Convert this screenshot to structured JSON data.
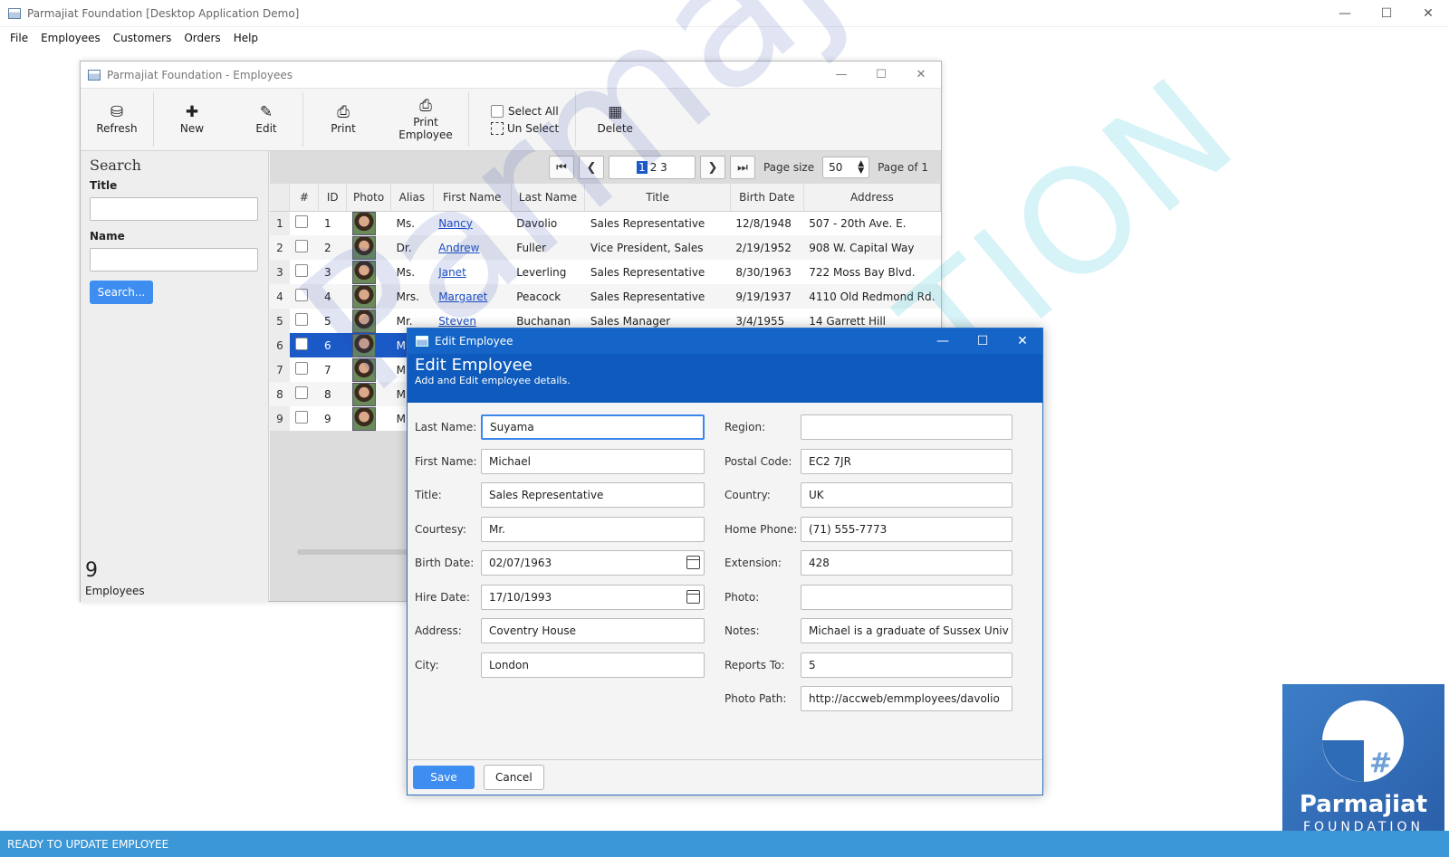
{
  "app": {
    "title": "Parmajiat Foundation [Desktop Application Demo]",
    "menu": [
      "File",
      "Employees",
      "Customers",
      "Orders",
      "Help"
    ],
    "status": "READY TO UPDATE EMPLOYEE"
  },
  "employees_window": {
    "title": "Parmajiat Foundation - Employees",
    "toolbar": {
      "refresh": "Refresh",
      "new": "New",
      "edit": "Edit",
      "print": "Print",
      "print_employee_1": "Print",
      "print_employee_2": "Employee",
      "select_all": "Select All",
      "un_select": "Un Select",
      "delete": "Delete"
    },
    "search": {
      "heading": "Search",
      "title_label": "Title",
      "name_label": "Name",
      "button": "Search..."
    },
    "count": "9",
    "count_label": "Employees",
    "pager": {
      "current_page": "1",
      "other_pages": "2 3",
      "page_size_label": "Page size",
      "page_size": "50",
      "page_of": "Page  of 1"
    },
    "columns": [
      "#",
      "ID",
      "Photo",
      "Alias",
      "First Name",
      "Last Name",
      "Title",
      "Birth Date",
      "Address"
    ],
    "rows": [
      {
        "num": "1",
        "id": "1",
        "alias": "Ms.",
        "first": "Nancy",
        "last": "Davolio",
        "title": "Sales Representative",
        "birth": "12/8/1948",
        "address": "507 - 20th Ave. E."
      },
      {
        "num": "2",
        "id": "2",
        "alias": "Dr.",
        "first": "Andrew",
        "last": "Fuller",
        "title": "Vice President, Sales",
        "birth": "2/19/1952",
        "address": "908 W. Capital Way"
      },
      {
        "num": "3",
        "id": "3",
        "alias": "Ms.",
        "first": "Janet",
        "last": "Leverling",
        "title": "Sales Representative",
        "birth": "8/30/1963",
        "address": "722 Moss Bay Blvd."
      },
      {
        "num": "4",
        "id": "4",
        "alias": "Mrs.",
        "first": "Margaret",
        "last": "Peacock",
        "title": "Sales Representative",
        "birth": "9/19/1937",
        "address": "4110 Old Redmond Rd."
      },
      {
        "num": "5",
        "id": "5",
        "alias": "Mr.",
        "first": "Steven",
        "last": "Buchanan",
        "title": "Sales Manager",
        "birth": "3/4/1955",
        "address": "14 Garrett Hill"
      },
      {
        "num": "6",
        "id": "6",
        "alias": "M",
        "first": "",
        "last": "",
        "title": "",
        "birth": "",
        "address": ""
      },
      {
        "num": "7",
        "id": "7",
        "alias": "M",
        "first": "",
        "last": "",
        "title": "",
        "birth": "",
        "address": ""
      },
      {
        "num": "8",
        "id": "8",
        "alias": "M",
        "first": "",
        "last": "",
        "title": "",
        "birth": "",
        "address": ""
      },
      {
        "num": "9",
        "id": "9",
        "alias": "M",
        "first": "",
        "last": "",
        "title": "",
        "birth": "",
        "address": ""
      }
    ]
  },
  "dialog": {
    "window_title": "Edit Employee",
    "heading": "Edit Employee",
    "subheading": "Add and Edit employee details.",
    "left": [
      {
        "label": "Last Name:",
        "value": "Suyama"
      },
      {
        "label": "First Name:",
        "value": "Michael"
      },
      {
        "label": "Title:",
        "value": "Sales Representative"
      },
      {
        "label": "Courtesy:",
        "value": "Mr."
      },
      {
        "label": "Birth Date:",
        "value": "02/07/1963"
      },
      {
        "label": "Hire Date:",
        "value": "17/10/1993"
      },
      {
        "label": "Address:",
        "value": "Coventry House"
      },
      {
        "label": "City:",
        "value": "London"
      }
    ],
    "right": [
      {
        "label": "Region:",
        "value": ""
      },
      {
        "label": "Postal Code:",
        "value": "EC2 7JR"
      },
      {
        "label": "Country:",
        "value": "UK"
      },
      {
        "label": "Home Phone:",
        "value": "(71) 555-7773"
      },
      {
        "label": "Extension:",
        "value": "428"
      },
      {
        "label": "Photo:",
        "value": ""
      },
      {
        "label": "Notes:",
        "value": "Michael is a graduate of Sussex Univ"
      },
      {
        "label": "Reports To:",
        "value": "5"
      },
      {
        "label": "Photo Path:",
        "value": "http://accweb/emmployees/davolio"
      }
    ],
    "save": "Save",
    "cancel": "Cancel"
  },
  "logo": {
    "name": "Parmajiat",
    "sub": "FOUNDATION"
  },
  "watermark": {
    "line1": "Parmajiat",
    "line2": "FOUNDATION"
  },
  "colors": {
    "accent": "#3d8ef0",
    "dialog_header": "#0e5bbd",
    "status_bar": "#3c97d6",
    "selection": "#1b59c7"
  }
}
